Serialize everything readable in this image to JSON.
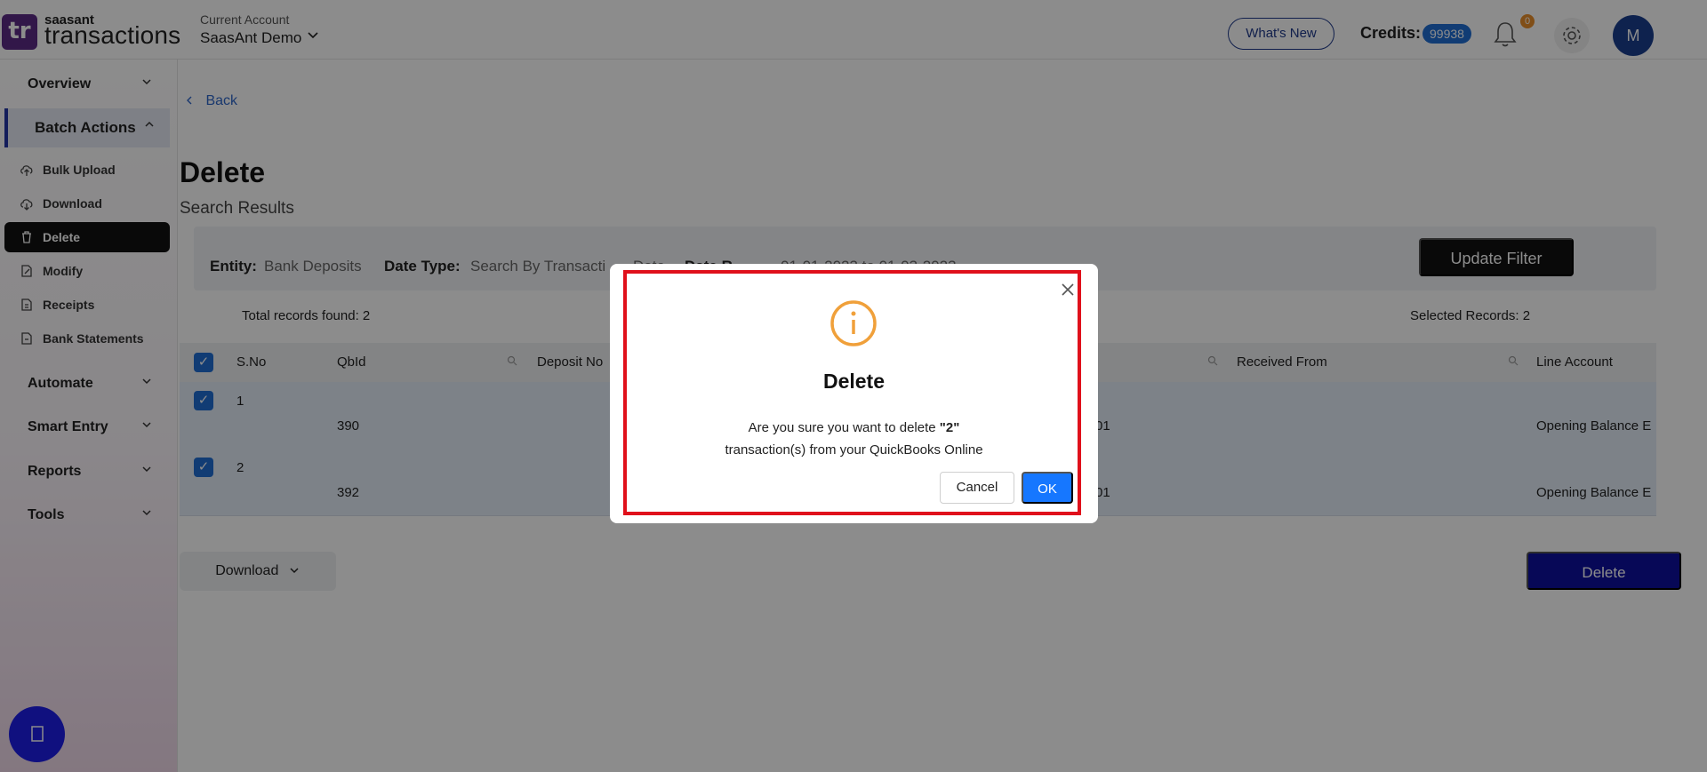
{
  "header": {
    "logo_mark": "tr",
    "logo_small": "saasant",
    "logo_big": "transactions",
    "account_label": "Current Account",
    "account_name": "SaasAnt Demo",
    "whats_new": "What's New",
    "credits_label": "Credits:",
    "credits_value": "99938",
    "notification_count": "0",
    "avatar_initial": "M"
  },
  "sidebar": {
    "overview": "Overview",
    "batch_actions": "Batch Actions",
    "items": [
      {
        "label": "Bulk Upload",
        "icon": "cloud-upload-icon"
      },
      {
        "label": "Download",
        "icon": "cloud-download-icon"
      },
      {
        "label": "Delete",
        "icon": "trash-icon"
      },
      {
        "label": "Modify",
        "icon": "edit-file-icon"
      },
      {
        "label": "Receipts",
        "icon": "receipt-icon"
      },
      {
        "label": "Bank Statements",
        "icon": "document-icon"
      }
    ],
    "sections": [
      "Automate",
      "Smart Entry",
      "Reports",
      "Tools"
    ]
  },
  "main": {
    "back": "Back",
    "title": "Delete",
    "subtitle": "Search Results",
    "filter": {
      "entity_label": "Entity:",
      "entity_value": "Bank Deposits",
      "date_type_label": "Date Type:",
      "date_type_value": "Search By Transacti",
      "date_range_partial": "Date",
      "date_range_label": "Date R",
      "date_range_value": "01-01-2023 to 01-03-2023"
    },
    "update_filter": "Update Filter",
    "total_records": "Total records found: 2",
    "selected_records": "Selected Records: 2",
    "columns": [
      "S.No",
      "QbId",
      "Deposit No",
      "Received From",
      "Line Account"
    ],
    "rows": [
      {
        "sno": "1",
        "qbid": "390",
        "date": "01",
        "line_account": "Opening Balance E"
      },
      {
        "sno": "2",
        "qbid": "392",
        "date": "01",
        "line_account": "Opening Balance E"
      }
    ],
    "download": "Download",
    "delete": "Delete"
  },
  "modal": {
    "title": "Delete",
    "message_prefix": "Are you sure you want to delete ",
    "message_count": "\"2\"",
    "message_line2": "transaction(s) from your QuickBooks Online",
    "cancel": "Cancel",
    "ok": "OK"
  },
  "colors": {
    "brand_purple": "#5b2a86",
    "primary_blue": "#1677ff",
    "delete_navy": "#0e0f9e",
    "highlight_red": "#e0101b",
    "warning_orange": "#f0a03a"
  }
}
